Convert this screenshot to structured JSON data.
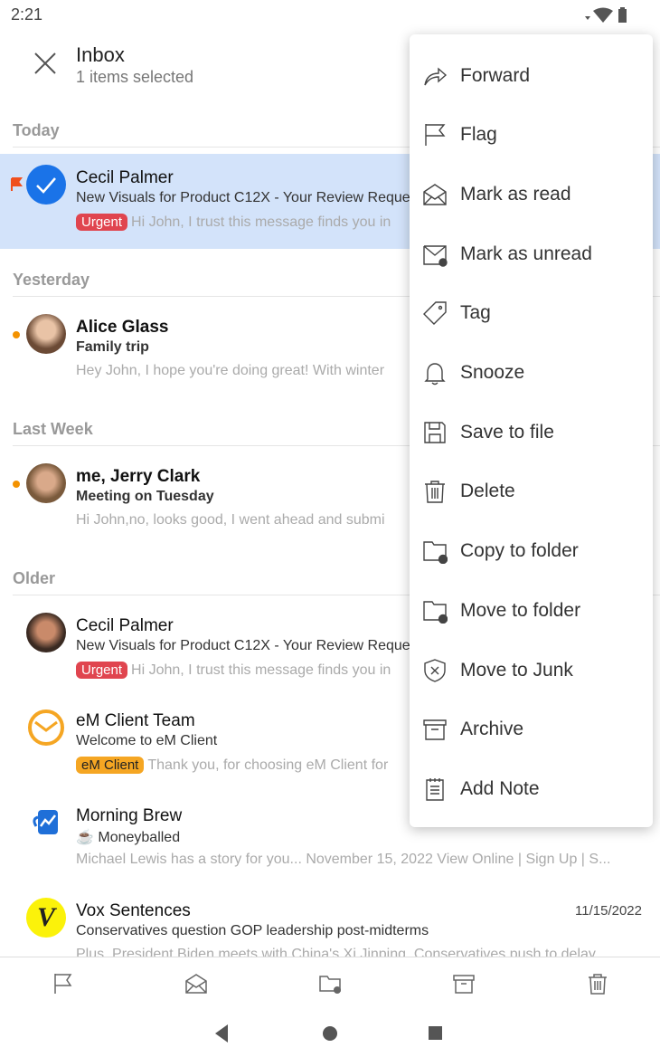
{
  "status": {
    "time": "2:21"
  },
  "header": {
    "title": "Inbox",
    "subtitle": "1 items selected"
  },
  "sections": [
    "Today",
    "Yesterday",
    "Last Week",
    "Older"
  ],
  "emails": [
    {
      "sender": "Cecil Palmer",
      "subject": "New Visuals for Product C12X - Your Review Reques",
      "badge": "Urgent",
      "preview": "Hi John, I trust this message finds you in",
      "selected": true,
      "flagged": true
    },
    {
      "sender": "Alice Glass",
      "subject": "Family trip",
      "preview": "Hey John, I hope you're doing great! With winter",
      "unread": true
    },
    {
      "sender": "me, Jerry Clark",
      "subject": "Meeting on Tuesday",
      "preview": "Hi John,no, looks good, I went ahead and submi",
      "unread": true
    },
    {
      "sender": "Cecil Palmer",
      "subject": "New Visuals for Product C12X - Your Review Reques",
      "badge": "Urgent",
      "preview": "Hi John, I trust this message finds you in"
    },
    {
      "sender": "eM Client Team",
      "subject": "Welcome to eM Client",
      "badge": "eM Client",
      "preview": "Thank you, for choosing eM Client for"
    },
    {
      "sender": "Morning Brew",
      "subject": "☕ Moneyballed",
      "preview": "Michael Lewis has a story for you... November 15, 2022 View Online | Sign Up | S..."
    },
    {
      "sender": "Vox Sentences",
      "subject": "Conservatives question GOP leadership post-midterms",
      "preview": "Plus, President Biden meets with China's Xi Jinping, Conservatives push to delay",
      "date": "11/15/2022"
    }
  ],
  "colors": {
    "accent": "#1a73e8",
    "urgent": "#e0454f",
    "emclient": "#f5a623",
    "selected_bg": "#d3e3fa",
    "flag": "#f0501e"
  },
  "menu": [
    "Forward",
    "Flag",
    "Mark as read",
    "Mark as unread",
    "Tag",
    "Snooze",
    "Save to file",
    "Delete",
    "Copy to folder",
    "Move to folder",
    "Move to Junk",
    "Archive",
    "Add Note"
  ]
}
